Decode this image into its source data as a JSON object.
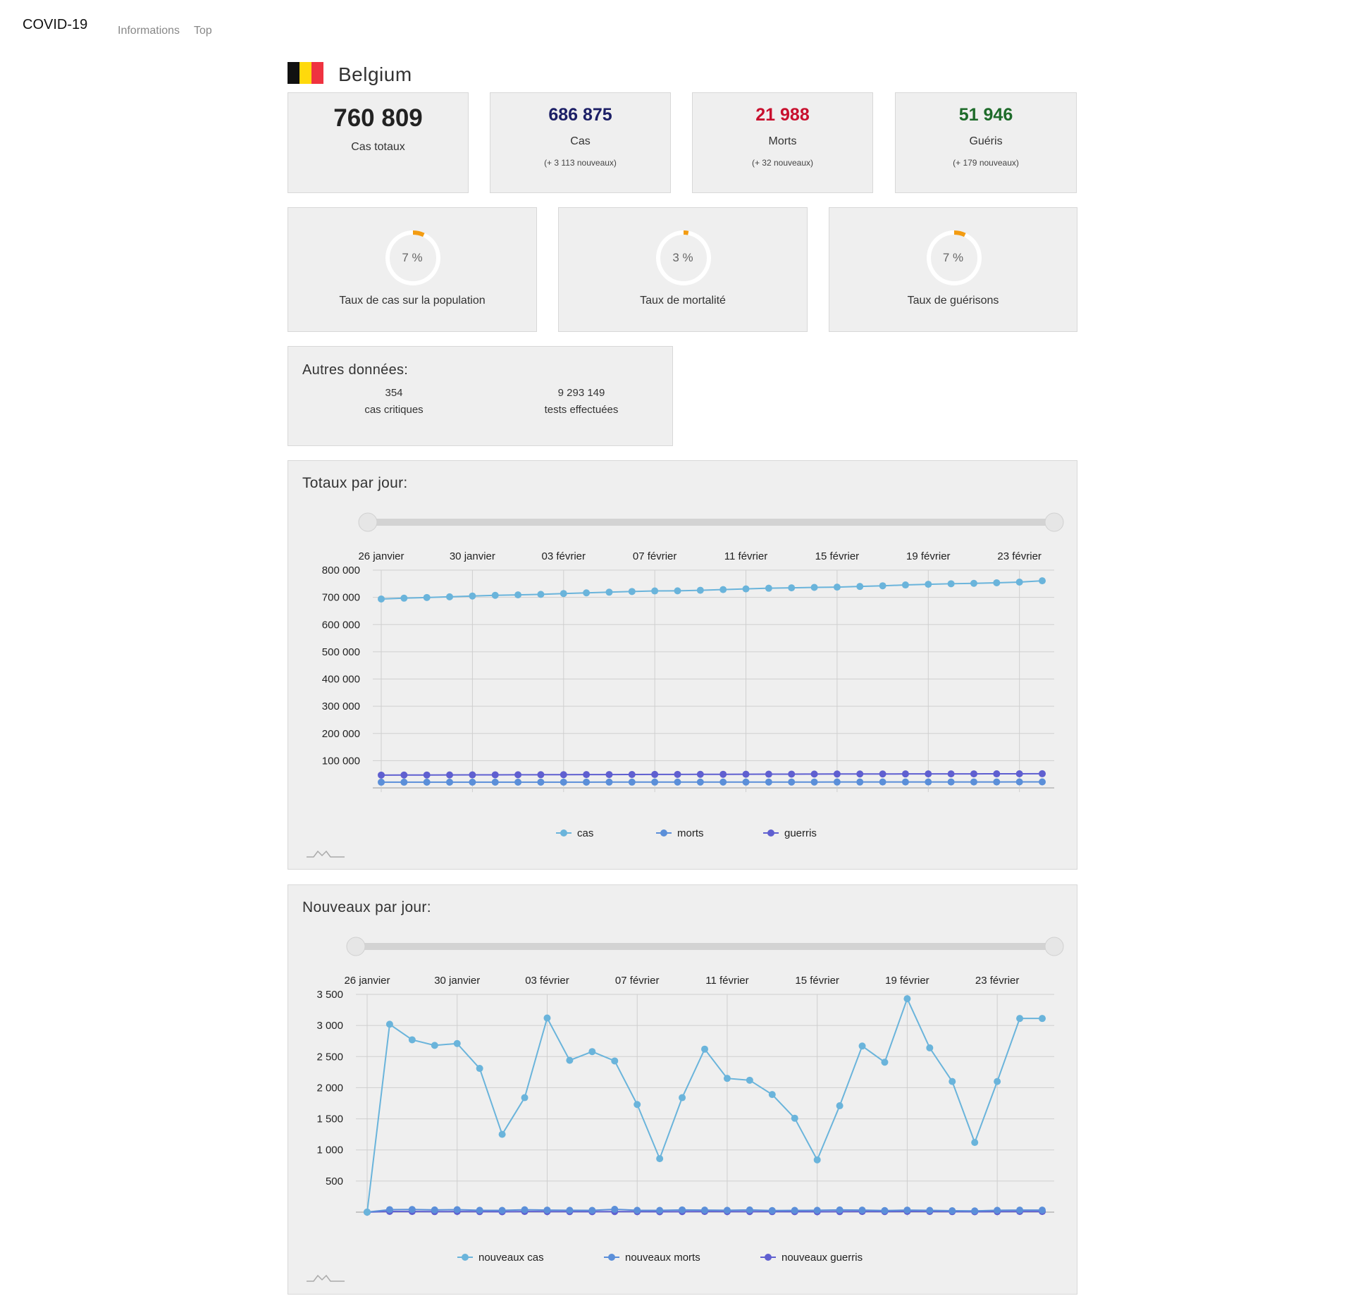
{
  "navbar": {
    "brand": "COVID-19",
    "links": [
      "Informations",
      "Top"
    ]
  },
  "country": {
    "name": "Belgium",
    "flag_colors": [
      "#111111",
      "#FFD90C",
      "#EF3340"
    ]
  },
  "stats": {
    "total": {
      "value": "760 809",
      "label": "Cas totaux"
    },
    "cases": {
      "value": "686 875",
      "label": "Cas",
      "new": "(+ 3 113 nouveaux)",
      "color": "#1c1f66"
    },
    "deaths": {
      "value": "21 988",
      "label": "Morts",
      "new": "(+ 32 nouveaux)",
      "color": "#c8102e"
    },
    "recovered": {
      "value": "51 946",
      "label": "Guéris",
      "new": "(+ 179 nouveaux)",
      "color": "#1e6b2a"
    }
  },
  "rates": [
    {
      "value": "7 %",
      "fraction": 0.07,
      "label": "Taux de cas sur la population"
    },
    {
      "value": "3 %",
      "fraction": 0.03,
      "label": "Taux de mortalité"
    },
    {
      "value": "7 %",
      "fraction": 0.07,
      "label": "Taux de guérisons"
    }
  ],
  "rate_ring_color": "#f39c12",
  "other": {
    "title": "Autres données:",
    "critical": {
      "value": "354",
      "label": "cas critiques"
    },
    "tests": {
      "value": "9 293 149",
      "label": "tests effectuées"
    }
  },
  "charts": {
    "totals_title": "Totaux par jour:",
    "new_title": "Nouveaux par jour:"
  },
  "chart_data": [
    {
      "type": "line",
      "title": "Totaux par jour:",
      "x": [
        "26 janvier",
        "27 janvier",
        "28 janvier",
        "29 janvier",
        "30 janvier",
        "31 janvier",
        "01 février",
        "02 février",
        "03 février",
        "04 février",
        "05 février",
        "06 février",
        "07 février",
        "08 février",
        "09 février",
        "10 février",
        "11 février",
        "12 février",
        "13 février",
        "14 février",
        "15 février",
        "16 février",
        "17 février",
        "18 février",
        "19 février",
        "20 février",
        "21 février",
        "22 février",
        "23 février",
        "24 février"
      ],
      "x_tick_labels": [
        "26 janvier",
        "30 janvier",
        "03 février",
        "07 février",
        "11 février",
        "15 février",
        "19 février",
        "23 février"
      ],
      "ylim": [
        0,
        800000
      ],
      "y_ticks": [
        100000,
        200000,
        300000,
        400000,
        500000,
        600000,
        700000,
        800000
      ],
      "y_tick_labels": [
        "100 000",
        "200 000",
        "300 000",
        "400 000",
        "500 000",
        "600 000",
        "700 000",
        "800 000"
      ],
      "grid": true,
      "legend": "bottom",
      "series": [
        {
          "name": "cas",
          "color": "#6ab4db",
          "values": [
            694000,
            697000,
            699500,
            702000,
            705000,
            707500,
            709000,
            711000,
            714000,
            716500,
            719000,
            721500,
            723500,
            724000,
            726000,
            728500,
            731000,
            733500,
            735000,
            736500,
            737500,
            740000,
            742500,
            745500,
            748000,
            750000,
            751500,
            753500,
            756000,
            760809
          ]
        },
        {
          "name": "morts",
          "color": "#5b8fd9",
          "values": [
            20900,
            20940,
            20970,
            21000,
            21040,
            21060,
            21080,
            21110,
            21140,
            21170,
            21200,
            21230,
            21270,
            21300,
            21330,
            21370,
            21400,
            21440,
            21480,
            21520,
            21560,
            21600,
            21640,
            21680,
            21720,
            21760,
            21800,
            21840,
            21950,
            21988
          ]
        },
        {
          "name": "guerris",
          "color": "#5f5fd0",
          "values": [
            47000,
            47200,
            47400,
            47600,
            47800,
            48000,
            48200,
            48400,
            48600,
            48800,
            49000,
            49200,
            49400,
            49600,
            49800,
            50000,
            50200,
            50400,
            50600,
            50800,
            51000,
            51100,
            51200,
            51300,
            51400,
            51500,
            51600,
            51700,
            51767,
            51946
          ]
        }
      ]
    },
    {
      "type": "line",
      "title": "Nouveaux par jour:",
      "x": [
        "26 janvier",
        "27 janvier",
        "28 janvier",
        "29 janvier",
        "30 janvier",
        "31 janvier",
        "01 février",
        "02 février",
        "03 février",
        "04 février",
        "05 février",
        "06 février",
        "07 février",
        "08 février",
        "09 février",
        "10 février",
        "11 février",
        "12 février",
        "13 février",
        "14 février",
        "15 février",
        "16 février",
        "17 février",
        "18 février",
        "19 février",
        "20 février",
        "21 février",
        "22 février",
        "23 février",
        "24 février",
        "25 février"
      ],
      "x_tick_labels": [
        "26 janvier",
        "30 janvier",
        "03 février",
        "07 février",
        "11 février",
        "15 février",
        "19 février",
        "23 février"
      ],
      "ylim": [
        0,
        3500
      ],
      "y_ticks": [
        500,
        1000,
        1500,
        2000,
        2500,
        3000,
        3500
      ],
      "y_tick_labels": [
        "500",
        "1 000",
        "1 500",
        "2 000",
        "2 500",
        "3 000",
        "3 500"
      ],
      "grid": true,
      "legend": "bottom",
      "series": [
        {
          "name": "nouveaux cas",
          "color": "#6ab4db",
          "values": [
            0,
            3020,
            2770,
            2680,
            2710,
            2310,
            1250,
            1840,
            3120,
            2440,
            2580,
            2430,
            1730,
            860,
            1840,
            2620,
            2150,
            2120,
            1890,
            1510,
            840,
            1710,
            2670,
            2410,
            3430,
            2640,
            2100,
            1120,
            2100,
            3113,
            3113
          ]
        },
        {
          "name": "nouveaux morts",
          "color": "#5b8fd9",
          "values": [
            0,
            40,
            42,
            35,
            40,
            30,
            28,
            38,
            33,
            30,
            28,
            45,
            30,
            28,
            36,
            32,
            30,
            35,
            25,
            28,
            30,
            35,
            32,
            25,
            33,
            28,
            22,
            20,
            30,
            32,
            32
          ]
        },
        {
          "name": "nouveaux guerris",
          "color": "#5f5fd0",
          "values": [
            0,
            12,
            10,
            8,
            10,
            8,
            6,
            10,
            9,
            8,
            7,
            9,
            8,
            6,
            9,
            10,
            9,
            9,
            8,
            7,
            6,
            8,
            10,
            9,
            12,
            10,
            8,
            6,
            8,
            10,
            10
          ]
        }
      ]
    }
  ]
}
